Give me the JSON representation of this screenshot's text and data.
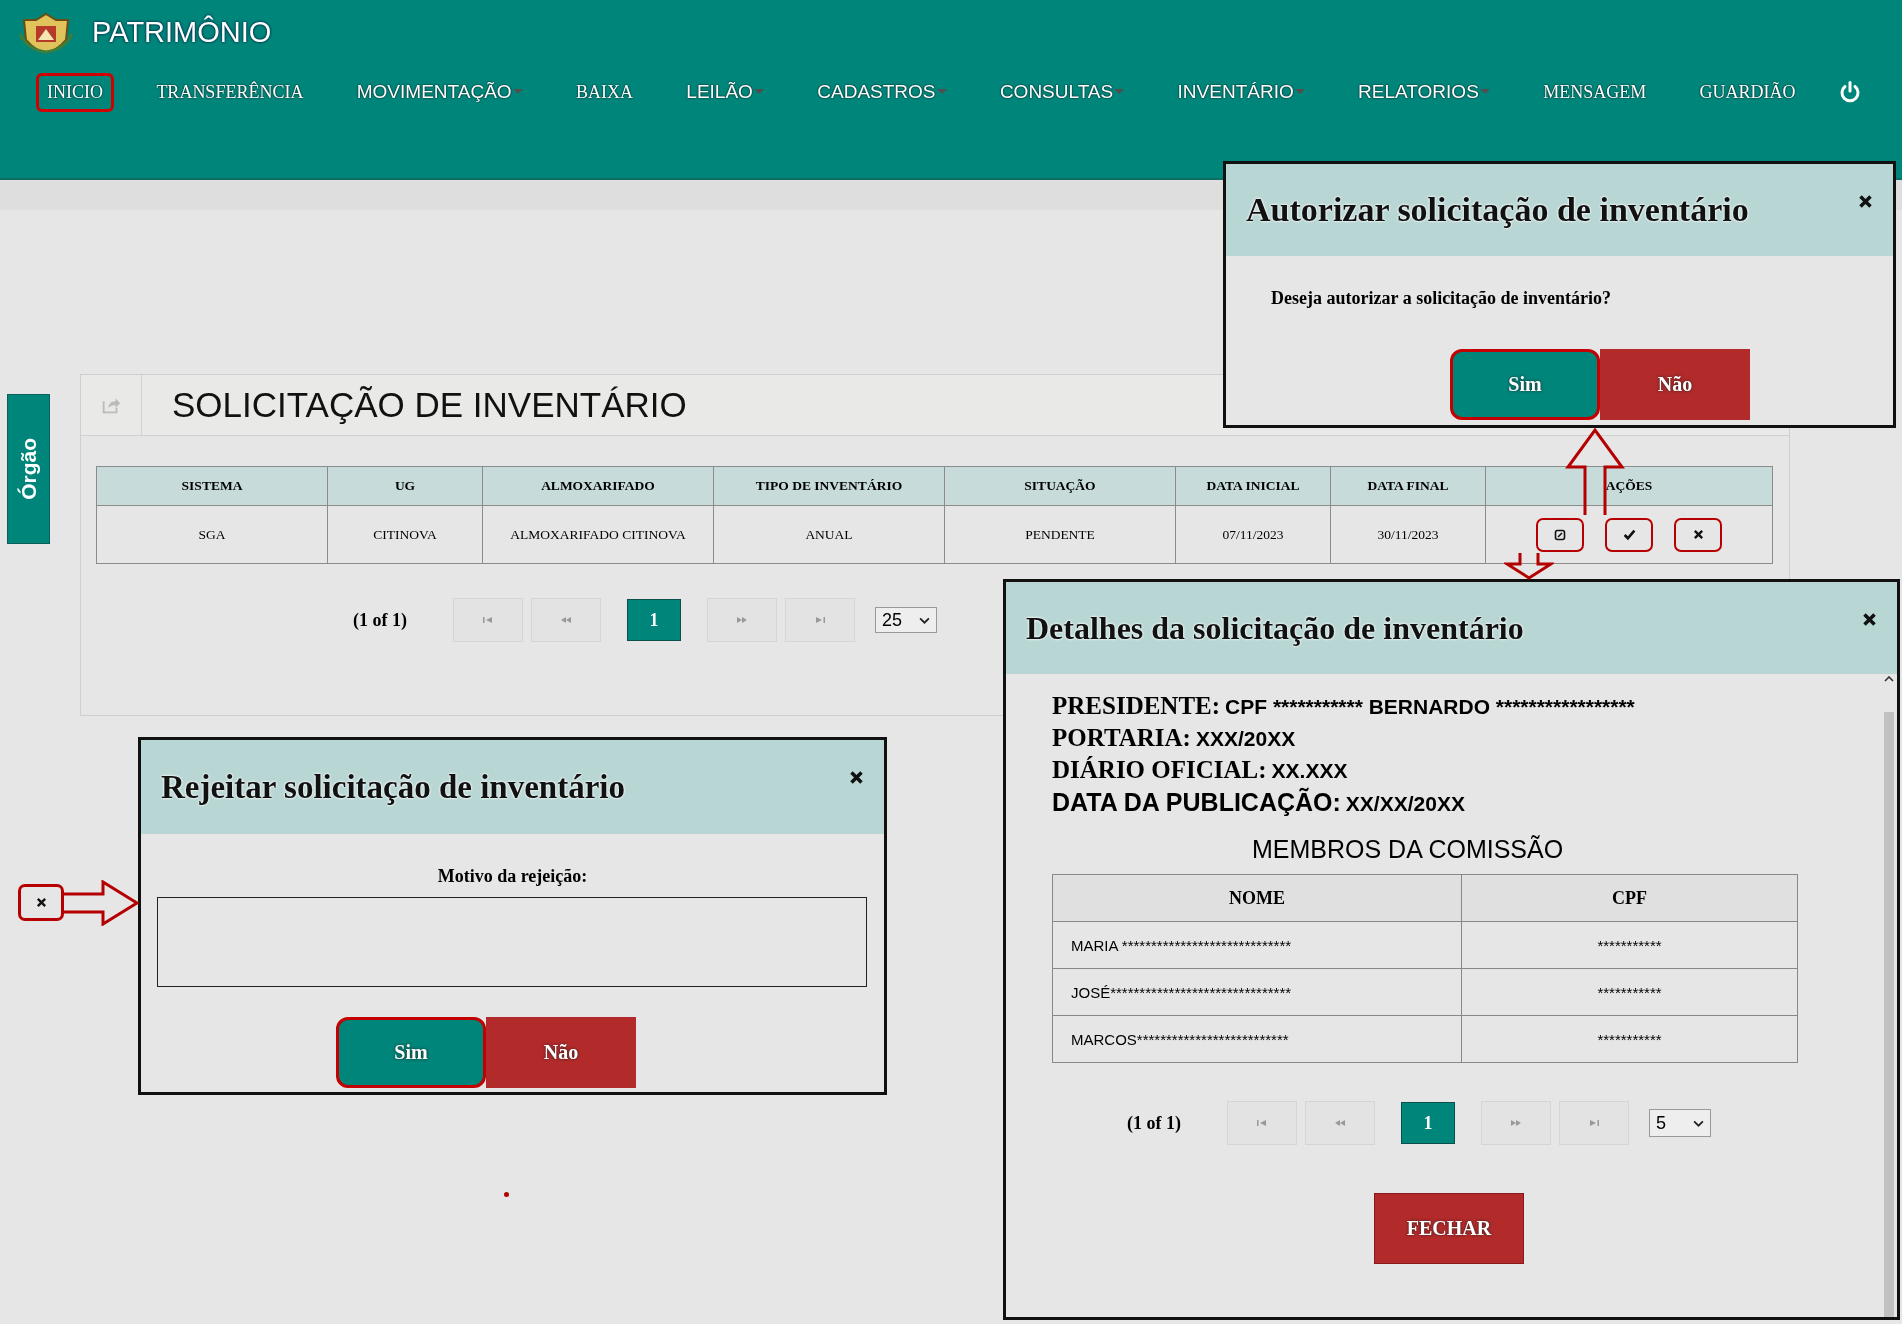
{
  "header": {
    "title": "PATRIMÔNIO"
  },
  "nav": [
    {
      "label": "INICIO",
      "kind": "link",
      "highlighted": true
    },
    {
      "label": "TRANSFERÊNCIA",
      "kind": "link",
      "highlighted": false
    },
    {
      "label": "MOVIMENTAÇÃO",
      "kind": "dropdown",
      "highlighted": false
    },
    {
      "label": "BAIXA",
      "kind": "link",
      "highlighted": false
    },
    {
      "label": "LEILÃO",
      "kind": "dropdown",
      "highlighted": false
    },
    {
      "label": "CADASTROS",
      "kind": "dropdown",
      "highlighted": false
    },
    {
      "label": "CONSULTAS",
      "kind": "dropdown",
      "highlighted": false
    },
    {
      "label": "INVENTÁRIO",
      "kind": "dropdown",
      "highlighted": false
    },
    {
      "label": "RELATORIOS",
      "kind": "dropdown",
      "highlighted": false
    },
    {
      "label": "MENSAGEM",
      "kind": "link",
      "highlighted": false
    },
    {
      "label": "GUARDIÃO",
      "kind": "link",
      "highlighted": false
    }
  ],
  "side_tab": {
    "label": "Órgão"
  },
  "panel": {
    "title": "SOLICITAÇÃO DE INVENTÁRIO"
  },
  "table": {
    "columns": [
      "SISTEMA",
      "UG",
      "ALMOXARIFADO",
      "TIPO DE INVENTÁRIO",
      "SITUAÇÃO",
      "DATA INICIAL",
      "DATA FINAL",
      "AÇÕES"
    ],
    "rows": [
      {
        "cells": [
          "SGA",
          "CITINOVA",
          "ALMOXARIFADO CITINOVA",
          "ANUAL",
          "PENDENTE",
          "07/11/2023",
          "30/11/2023"
        ]
      }
    ]
  },
  "pagination": {
    "summary": "(1 of 1)",
    "pages": [
      {
        "label": "1",
        "selected": true
      }
    ],
    "page_size": "25"
  },
  "authorize_dialog": {
    "title": "Autorizar solicitação de inventário",
    "message": "Deseja autorizar a solicitação de inventário?",
    "buttons": [
      {
        "label": "Sim",
        "kind": "confirm",
        "highlighted": true
      },
      {
        "label": "Não",
        "kind": "cancel",
        "highlighted": false
      }
    ]
  },
  "reject_dialog": {
    "title": "Rejeitar solicitação de inventário",
    "field_label": "Motivo da rejeição:",
    "buttons": [
      {
        "label": "Sim",
        "kind": "confirm",
        "highlighted": true
      },
      {
        "label": "Não",
        "kind": "cancel",
        "highlighted": false
      }
    ]
  },
  "details_dialog": {
    "title": "Detalhes da solicitação de inventário",
    "fields": [
      {
        "label": "PRESIDENTE:",
        "value": "CPF *********** BERNARDO *****************"
      },
      {
        "label": "PORTARIA:",
        "value": "XXX/20XX"
      },
      {
        "label": "DIÁRIO OFICIAL:",
        "value": "XX.XXX"
      },
      {
        "label": "DATA DA PUBLICAÇÃO:",
        "value": "XX/XX/20XX"
      }
    ],
    "members_title": "MEMBROS DA COMISSÃO",
    "columns": [
      "NOME",
      "CPF"
    ],
    "rows": [
      {
        "cells": [
          "MARIA *****************************",
          "***********"
        ]
      },
      {
        "cells": [
          "JOSÉ*******************************",
          "***********"
        ]
      },
      {
        "cells": [
          "MARCOS**************************",
          "***********"
        ]
      }
    ],
    "pagination": {
      "summary": "(1 of 1)",
      "pages": [
        {
          "label": "1",
          "selected": true
        }
      ],
      "page_size": "5"
    },
    "close_button": "FECHAR"
  }
}
